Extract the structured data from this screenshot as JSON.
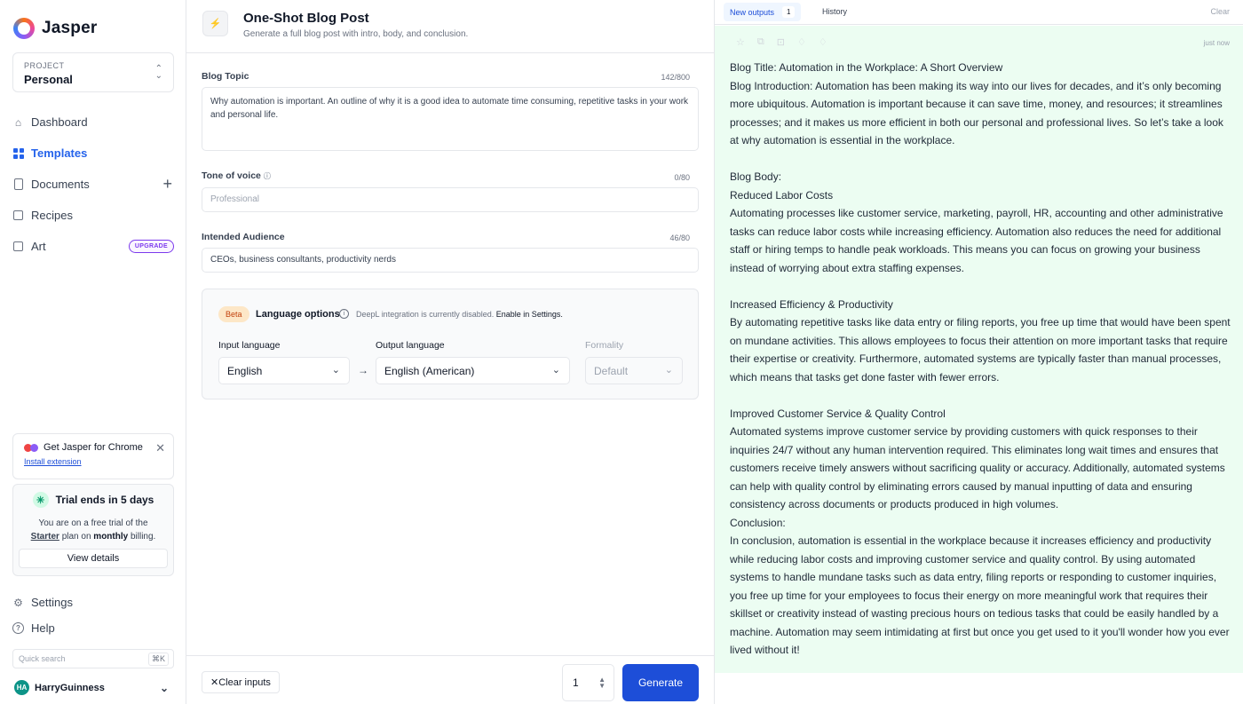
{
  "app": {
    "name": "Jasper"
  },
  "project": {
    "label": "PROJECT",
    "name": "Personal"
  },
  "nav": {
    "dashboard": "Dashboard",
    "templates": "Templates",
    "documents": "Documents",
    "recipes": "Recipes",
    "art": "Art",
    "upgrade_badge": "UPGRADE"
  },
  "chrome_promo": {
    "title": "Get Jasper for Chrome",
    "link": "Install extension"
  },
  "trial": {
    "title": "Trial ends in 5 days",
    "line1": "You are on a free trial of the",
    "plan": "Starter",
    "mid": "plan on",
    "billing": "monthly",
    "end": "billing.",
    "button": "View details"
  },
  "bottom_nav": {
    "settings": "Settings",
    "help": "Help"
  },
  "quick_search": {
    "placeholder": "Quick search",
    "shortcut": "⌘K"
  },
  "user": {
    "initials": "HA",
    "name": "HarryGuinness"
  },
  "template": {
    "title": "One-Shot Blog Post",
    "description": "Generate a full blog post with intro, body, and conclusion."
  },
  "form": {
    "topic": {
      "label": "Blog Topic",
      "counter": "142/800",
      "value": "Why automation is important. An outline of why it is a good idea to automate time consuming, repetitive tasks in your work and personal life."
    },
    "tone": {
      "label": "Tone of voice",
      "counter": "0/80",
      "placeholder": "Professional"
    },
    "audience": {
      "label": "Intended Audience",
      "counter": "46/80",
      "value": "CEOs, business consultants, productivity nerds"
    }
  },
  "language": {
    "beta": "Beta",
    "title": "Language options",
    "note": "DeepL integration is currently disabled.",
    "note_link": "Enable in Settings.",
    "input_label": "Input language",
    "input_value": "English",
    "output_label": "Output language",
    "output_value": "English (American)",
    "formality_label": "Formality",
    "formality_value": "Default"
  },
  "footer": {
    "clear": "Clear inputs",
    "quantity": "1",
    "generate": "Generate"
  },
  "outputs": {
    "tab_new": "New outputs",
    "tab_count": "1",
    "tab_history": "History",
    "clear": "Clear",
    "time": "just now",
    "lines": [
      "Blog Title: Automation in the Workplace: A Short Overview",
      "Blog Introduction: Automation has been making its way into our lives for decades, and it’s only becoming more ubiquitous. Automation is important because it can save time, money, and resources; it streamlines processes; and it makes us more efficient in both our personal and professional lives. So let’s take a look at why automation is essential in the workplace.",
      "",
      "Blog Body:",
      "Reduced Labor Costs",
      "Automating processes like customer service, marketing, payroll, HR, accounting and other administrative tasks can reduce labor costs while increasing efficiency. Automation also reduces the need for additional staff or hiring temps to handle peak workloads. This means you can focus on growing your business instead of worrying about extra staffing expenses.",
      "",
      "Increased Efficiency & Productivity",
      "By automating repetitive tasks like data entry or filing reports, you free up time that would have been spent on mundane activities. This allows employees to focus their attention on more important tasks that require their expertise or creativity. Furthermore, automated systems are typically faster than manual processes, which means that tasks get done faster with fewer errors.",
      "",
      "Improved Customer Service & Quality Control",
      "Automated systems improve customer service by providing customers with quick responses to their inquiries 24/7 without any human intervention required. This eliminates long wait times and ensures that customers receive timely answers without sacrificing quality or accuracy. Additionally, automated systems can help with quality control by eliminating errors caused by manual inputting of data and ensuring consistency across documents or products produced in high volumes.",
      "Conclusion:",
      "In conclusion, automation is essential in the workplace because it increases efficiency and productivity while reducing labor costs and improving customer service and quality control. By using automated systems to handle mundane tasks such as data entry, filing reports or responding to customer inquiries, you free up time for your employees to focus their energy on more meaningful work that requires their skillset or creativity instead of wasting precious hours on tedious tasks that could be easily handled by a machine. Automation may seem intimidating at first but once you get used to it you'll wonder how you ever lived without it!"
    ]
  },
  "colors": {
    "accent": "#1d4ed8",
    "output_bg": "#ecfdf2",
    "upgrade": "#7c3aed"
  }
}
